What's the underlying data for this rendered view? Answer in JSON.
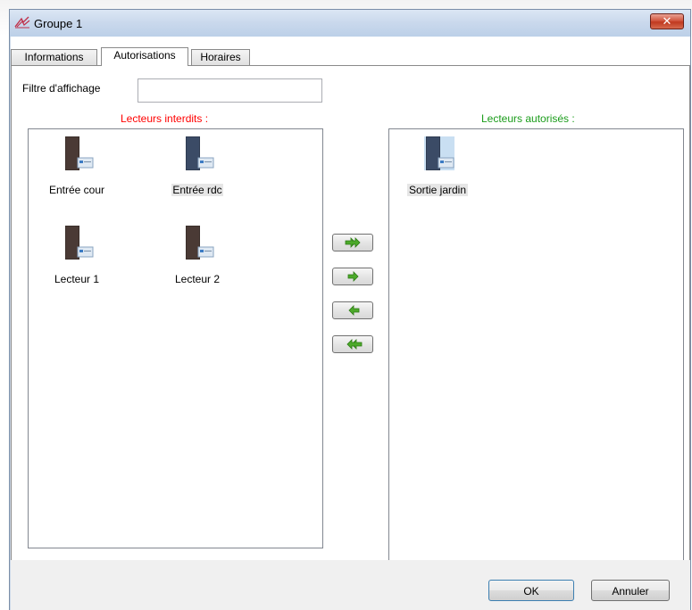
{
  "window": {
    "title": "Groupe 1",
    "close_label": "✕"
  },
  "tabs": [
    {
      "label": "Informations",
      "active": false
    },
    {
      "label": "Autorisations",
      "active": true
    },
    {
      "label": "Horaires",
      "active": false
    }
  ],
  "filter": {
    "label": "Filtre d'affichage",
    "value": "",
    "placeholder": ""
  },
  "denied": {
    "caption": "Lecteurs interdits :",
    "caption_color": "#ff0000",
    "items": [
      {
        "label": "Entrée cour",
        "icon": "card-reader-icon",
        "selected": false
      },
      {
        "label": "Entrée rdc",
        "icon": "card-reader-icon",
        "selected": true
      },
      {
        "label": "Lecteur 1",
        "icon": "card-reader-icon",
        "selected": false
      },
      {
        "label": "Lecteur 2",
        "icon": "card-reader-icon",
        "selected": false
      }
    ]
  },
  "allowed": {
    "caption": "Lecteurs autorisés :",
    "caption_color": "#1a9c1a",
    "items": [
      {
        "label": "Sortie jardin",
        "icon": "card-reader-icon",
        "selected": true
      }
    ]
  },
  "move_buttons": [
    {
      "name": "move-all-right-button",
      "icon": "double-arrow-right-icon"
    },
    {
      "name": "move-right-button",
      "icon": "arrow-right-icon"
    },
    {
      "name": "move-left-button",
      "icon": "arrow-left-icon"
    },
    {
      "name": "move-all-left-button",
      "icon": "double-arrow-left-icon"
    }
  ],
  "footer": {
    "ok_label": "OK",
    "cancel_label": "Annuler"
  }
}
